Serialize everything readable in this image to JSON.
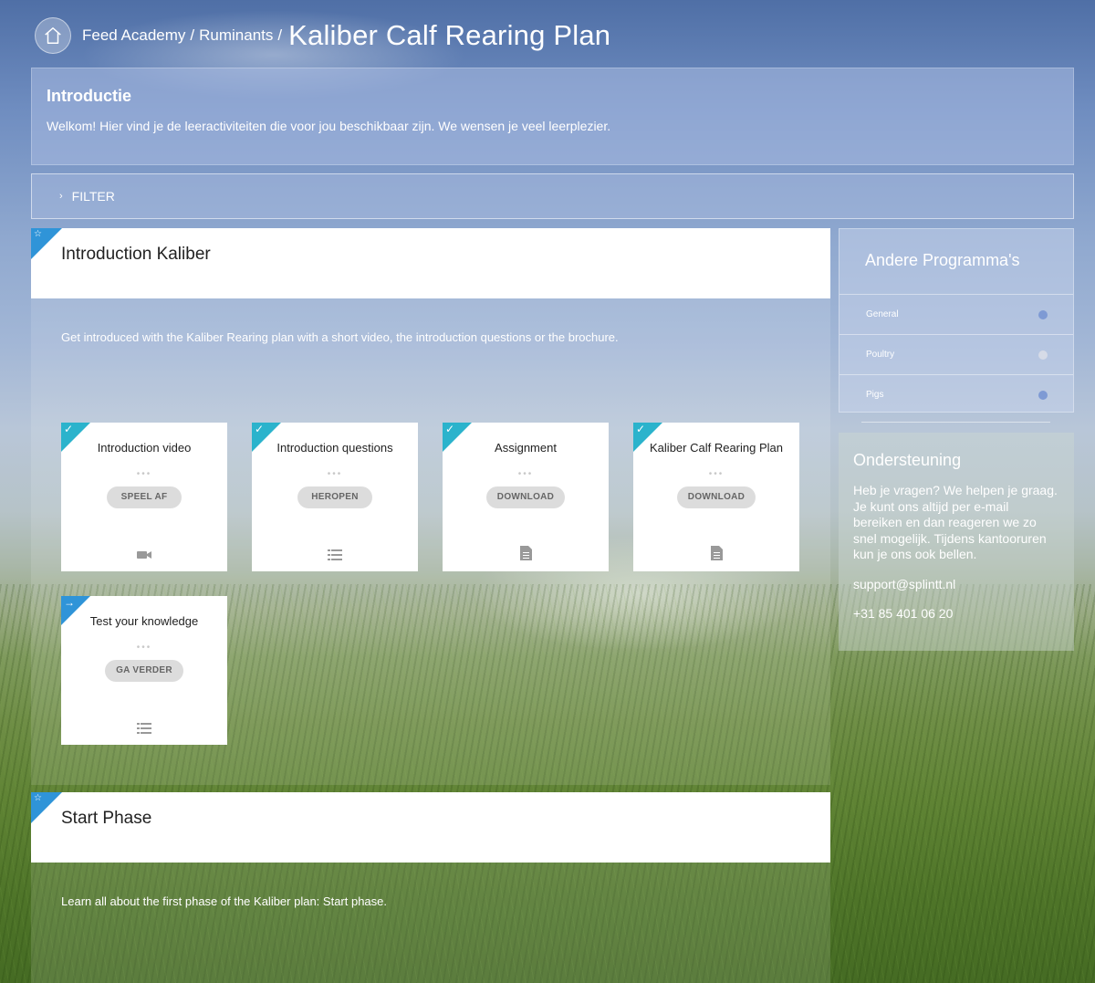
{
  "breadcrumb": {
    "items": [
      "Feed Academy",
      "Ruminants"
    ],
    "separator": "/",
    "current": "Kaliber Calf Rearing Plan"
  },
  "intro": {
    "title": "Introductie",
    "text": "Welkom! Hier vind je de leeractiviteiten die voor jou beschikbaar zijn. We wensen je veel leerplezier."
  },
  "filter": {
    "label": "FILTER"
  },
  "sections": [
    {
      "title": "Introduction Kaliber",
      "description": "Get introduced with the Kaliber Rearing plan with a short video, the introduction questions or the brochure.",
      "tiles": [
        {
          "title": "Introduction video",
          "button": "SPEEL AF",
          "status_icon": "check-icon",
          "type_icon": "video-camera-icon"
        },
        {
          "title": "Introduction questions",
          "button": "HEROPEN",
          "status_icon": "check-icon",
          "type_icon": "list-icon"
        },
        {
          "title": "Assignment",
          "button": "DOWNLOAD",
          "status_icon": "check-icon",
          "type_icon": "document-icon"
        },
        {
          "title": "Kaliber Calf Rearing Plan",
          "button": "DOWNLOAD",
          "status_icon": "check-icon",
          "type_icon": "document-icon"
        },
        {
          "title": "Test your knowledge",
          "button": "GA VERDER",
          "status_icon": "arrow-right-icon",
          "type_icon": "list-icon"
        }
      ]
    },
    {
      "title": "Start Phase",
      "description": "Learn all about the first phase of the Kaliber plan: Start phase."
    }
  ],
  "sidebar": {
    "programs_title": "Andere Programma's",
    "programs": [
      {
        "label": "General",
        "dot_color": "#7e9ad4"
      },
      {
        "label": "Poultry",
        "dot_color": "#d6dbe7"
      },
      {
        "label": "Pigs",
        "dot_color": "#7e9ad4"
      }
    ],
    "support": {
      "title": "Ondersteuning",
      "text": "Heb je vragen? We helpen je graag. Je kunt ons altijd per e-mail bereiken en dan reageren we zo snel mogelijk. Tijdens kantooruren kun je ons ook bellen.",
      "email": "support@splintt.nl",
      "phone": "+31 85 401 06 20"
    }
  },
  "colors": {
    "corner_section": "#2f94d8",
    "corner_done": "#2bb3cc",
    "button_bg": "#dcdcdc"
  }
}
